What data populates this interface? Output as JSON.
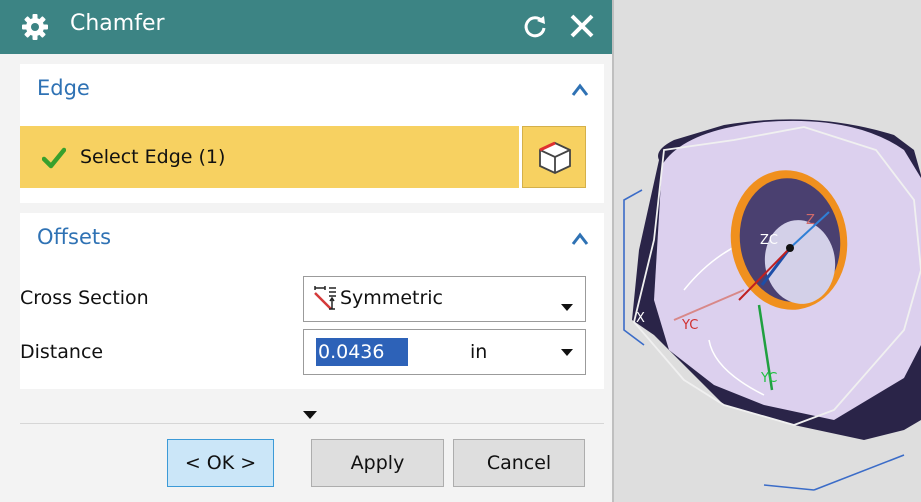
{
  "dialog": {
    "title": "Chamfer",
    "title_icon": "gear-icon",
    "reset_icon": "reset-icon",
    "close_icon": "close-icon"
  },
  "edge": {
    "header": "Edge",
    "select_label": "Select Edge (1)",
    "select_status_icon": "checkmark-icon",
    "select_button_icon": "cube-edge-icon"
  },
  "offsets": {
    "header": "Offsets",
    "cross_section": {
      "label": "Cross Section",
      "value": "Symmetric",
      "icon": "symmetric-icon"
    },
    "distance": {
      "label": "Distance",
      "value": "0.0436",
      "unit": "in"
    }
  },
  "buttons": {
    "ok": "< OK >",
    "apply": "Apply",
    "cancel": "Cancel"
  },
  "viewport": {
    "labels": [
      "ZC",
      "Z",
      "YC",
      "YC",
      "X"
    ]
  },
  "colors": {
    "titlebar": "#3c8484",
    "section_header_text": "#2f72b4",
    "selection_highlight": "#f7d161",
    "check_green": "#38a02d",
    "input_selection": "#2d62b8",
    "ok_button": "#cbe6f8",
    "part_face": "#dcd0ee",
    "part_side": "#2a2448",
    "hole_edge": "#f0901e"
  }
}
